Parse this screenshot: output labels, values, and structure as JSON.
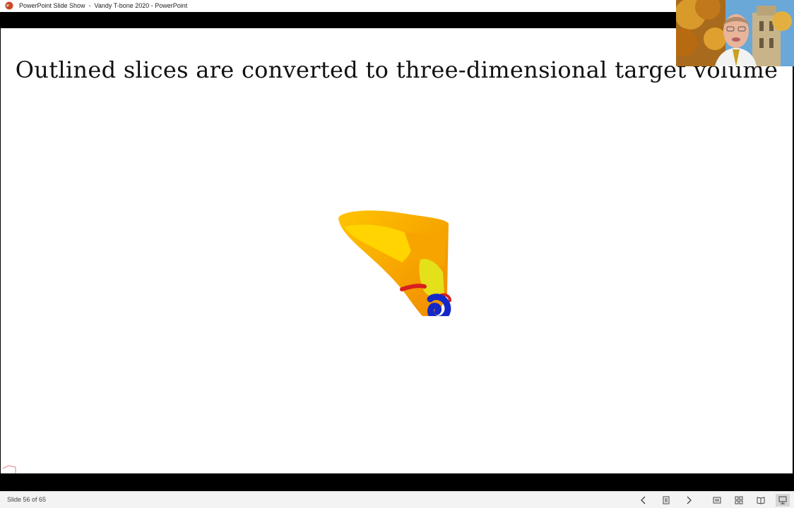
{
  "window": {
    "title": "PowerPoint Slide Show  -  Vandy T-bone 2020 - PowerPoint",
    "app_icon": "powerpoint-icon"
  },
  "slide": {
    "title": "Outlined slices are converted to three-dimensional target volume",
    "image": "3d-temporal-bone-model"
  },
  "webcam": {
    "content": "presenter-video-feed"
  },
  "statusbar": {
    "slide_counter": "Slide 56 of 65",
    "buttons": [
      {
        "icon": "previous-icon"
      },
      {
        "icon": "slide-list-icon"
      },
      {
        "icon": "next-icon"
      },
      {
        "icon": "normal-view-icon"
      },
      {
        "icon": "slide-sorter-icon"
      },
      {
        "icon": "reading-view-icon"
      },
      {
        "icon": "slide-show-icon"
      }
    ]
  },
  "colors": {
    "powerpoint_brand": "#D24726",
    "bone_orange": "#F5A000",
    "bone_yellow": "#FFD400",
    "structure_red": "#D8201E",
    "cochlea_blue": "#1428C8"
  }
}
